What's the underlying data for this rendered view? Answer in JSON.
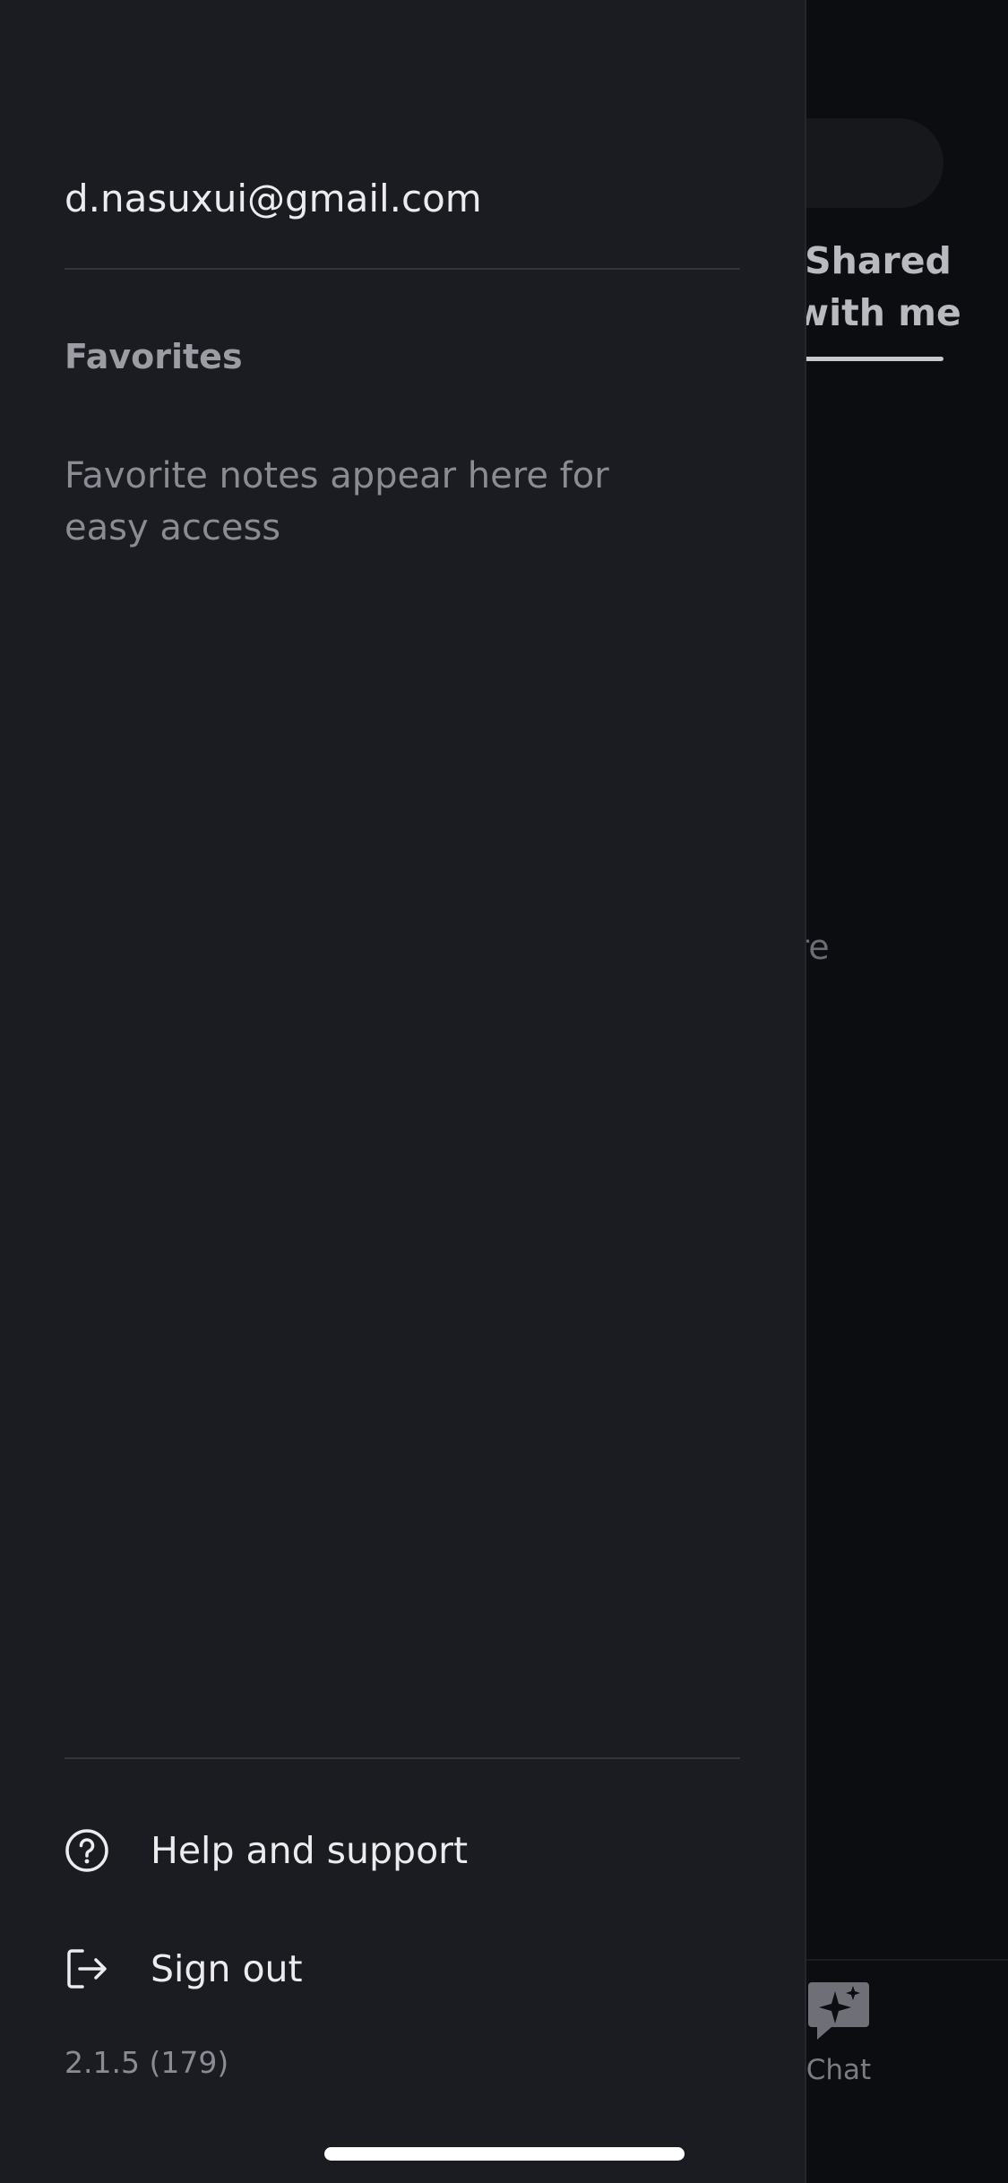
{
  "background": {
    "tab_shared_line1": "Shared",
    "tab_shared_line2": "with me",
    "empty_text_fragment": "here",
    "bottom_nav": {
      "chat_label": "Chat",
      "chat_icon": "chat-sparkle-icon"
    }
  },
  "drawer": {
    "account_email": "d.nasuxui@gmail.com",
    "favorites": {
      "title": "Favorites",
      "empty_message": "Favorite notes appear here for easy access"
    },
    "menu": [
      {
        "label": "Help and support",
        "icon": "help-circle-icon"
      },
      {
        "label": "Sign out",
        "icon": "sign-out-icon"
      }
    ],
    "version": "2.1.5 (179)"
  },
  "colors": {
    "drawer_bg": "#1b1c21",
    "app_bg": "#0c0d10",
    "primary_text": "#ececef",
    "muted_text": "#8a8b93"
  }
}
